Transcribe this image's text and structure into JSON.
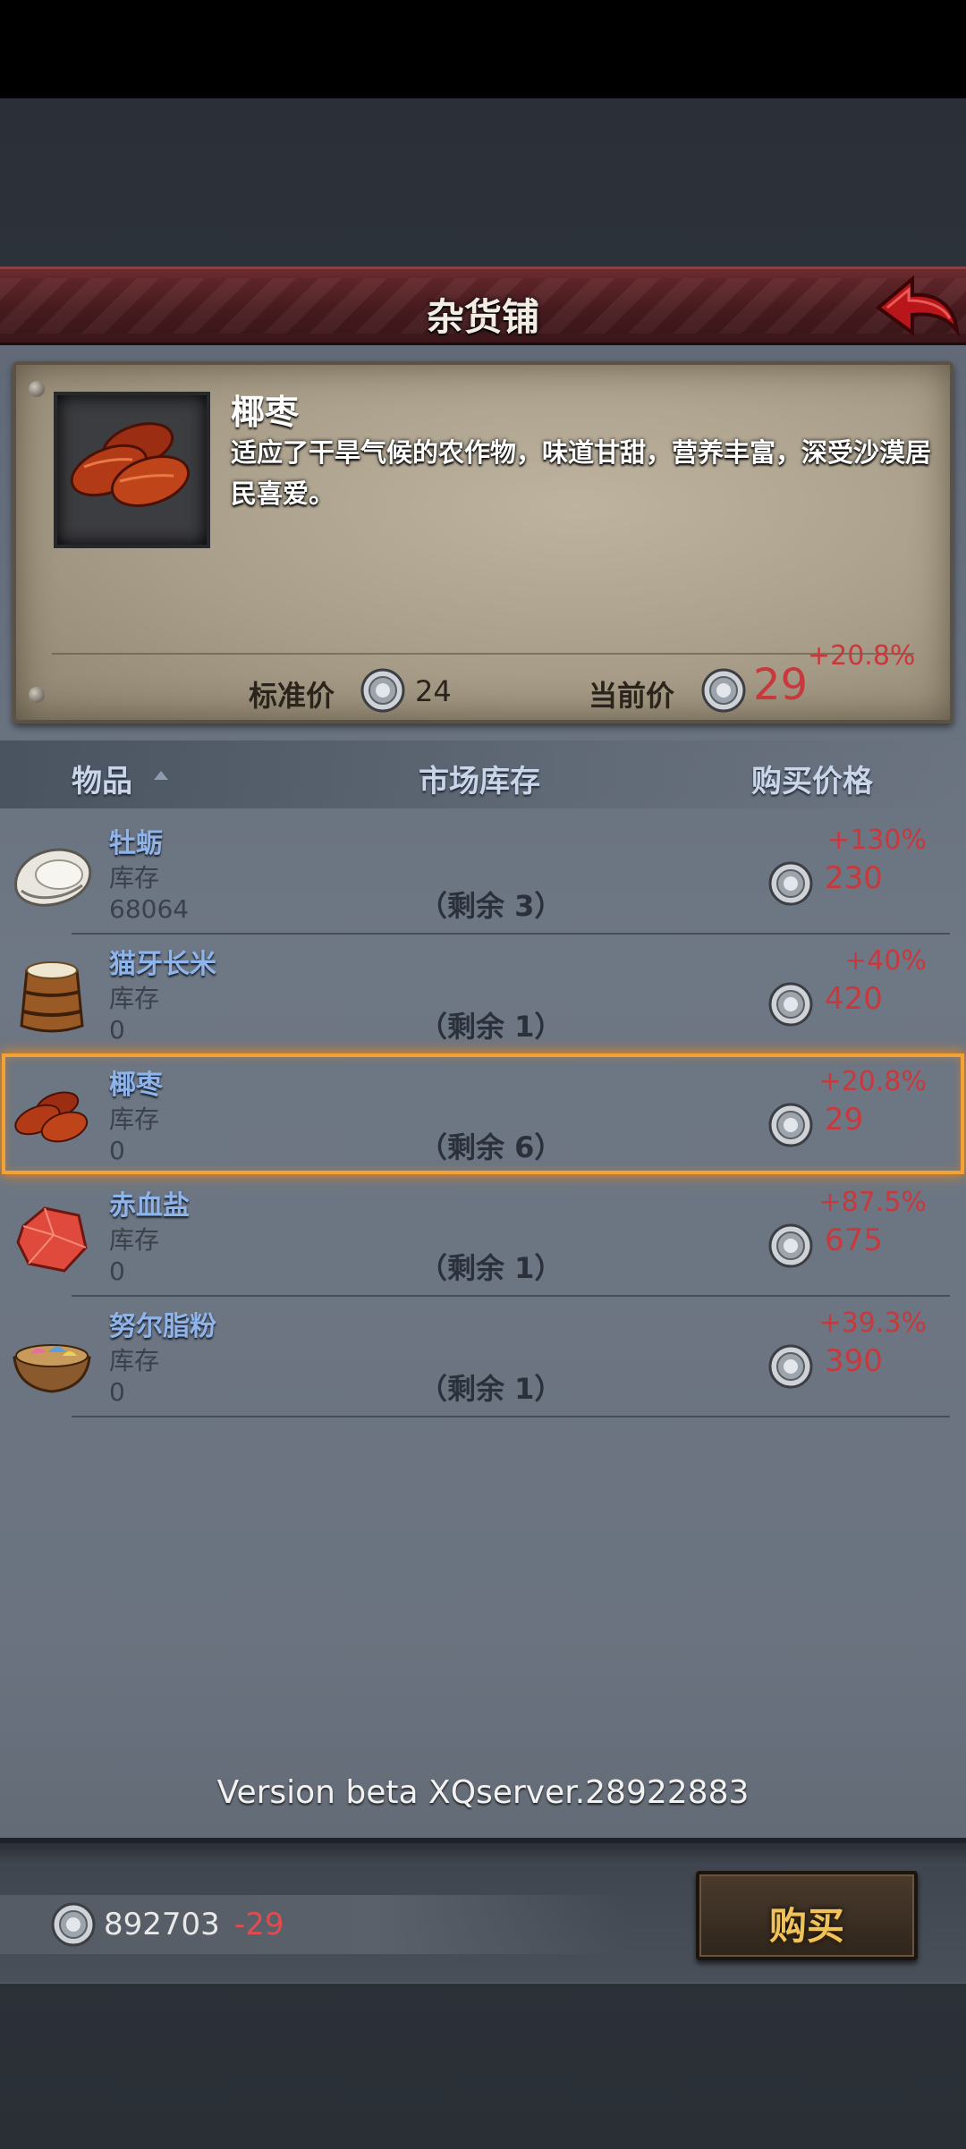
{
  "header": {
    "title": "杂货铺"
  },
  "detail": {
    "name": "椰枣",
    "description": "适应了干旱气候的农作物，味道甘甜，营养丰富，深受沙漠居民喜爱。",
    "standard_price_label": "标准价",
    "standard_price": "24",
    "current_price_label": "当前价",
    "current_price": "29",
    "current_change": "+20.8%"
  },
  "table": {
    "columns": [
      "物品",
      "市场库存",
      "购买价格"
    ],
    "rows": [
      {
        "name": "牡蛎",
        "stock_label": "库存",
        "stock": "68064",
        "remaining": "（剩余 3）",
        "change": "+130%",
        "price": "230",
        "icon": "oyster-icon"
      },
      {
        "name": "猫牙长米",
        "stock_label": "库存",
        "stock": "0",
        "remaining": "（剩余 1）",
        "change": "+40%",
        "price": "420",
        "icon": "rice-barrel-icon"
      },
      {
        "name": "椰枣",
        "stock_label": "库存",
        "stock": "0",
        "remaining": "（剩余 6）",
        "change": "+20.8%",
        "price": "29",
        "icon": "dates-icon",
        "selected": true
      },
      {
        "name": "赤血盐",
        "stock_label": "库存",
        "stock": "0",
        "remaining": "（剩余 1）",
        "change": "+87.5%",
        "price": "675",
        "icon": "red-salt-icon"
      },
      {
        "name": "努尔脂粉",
        "stock_label": "库存",
        "stock": "0",
        "remaining": "（剩余 1）",
        "change": "+39.3%",
        "price": "390",
        "icon": "powder-bowl-icon"
      }
    ]
  },
  "version": "Version beta XQserver.28922883",
  "footer": {
    "money": "892703",
    "money_delta": "-29",
    "buy_label": "购买"
  },
  "colors": {
    "accent_red": "#c8383c",
    "highlight": "#f6a136",
    "name_blue": "#8fb4ea",
    "buy_gold": "#f0c35a"
  }
}
